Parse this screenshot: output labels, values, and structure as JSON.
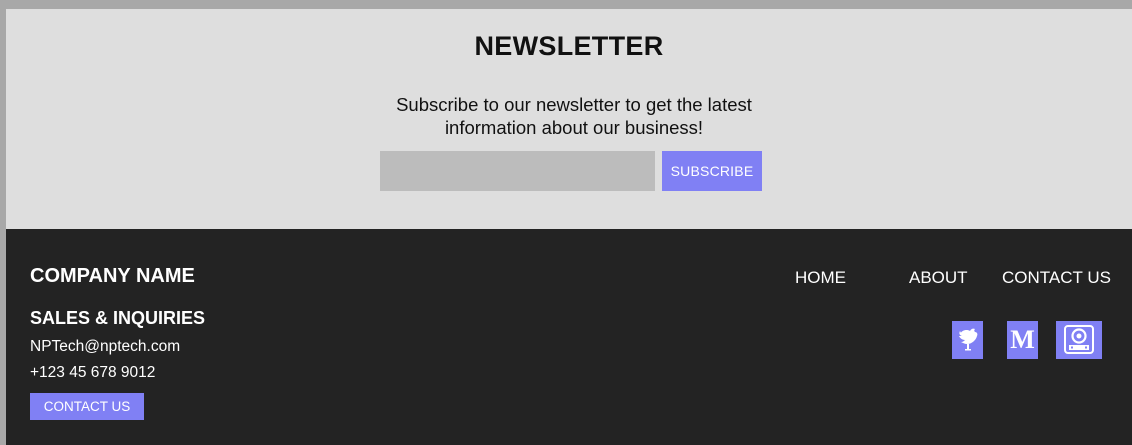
{
  "newsletter": {
    "title": "NEWSLETTER",
    "description_line1": "Subscribe to our newsletter to get the latest",
    "description_line2": "information about our business!",
    "email_input": {
      "value": "",
      "placeholder": ""
    },
    "subscribe_label": "SUBSCRIBE"
  },
  "footer": {
    "company_name": "COMPANY NAME",
    "sales_heading": "SALES & INQUIRIES",
    "email": "NPTech@nptech.com",
    "phone": "+123 45 678 9012",
    "contact_button_label": "CONTACT US",
    "nav": {
      "home": "HOME",
      "about": "ABOUT",
      "contact": "CONTACT US"
    },
    "social": [
      {
        "icon": "bird-icon"
      },
      {
        "icon": "medium-icon",
        "glyph": "M"
      },
      {
        "icon": "podcast-icon"
      }
    ]
  },
  "colors": {
    "accent": "#8080f4",
    "newsletter_background": "#dedede",
    "input_background": "#bcbcbc",
    "footer_background": "#232323"
  }
}
